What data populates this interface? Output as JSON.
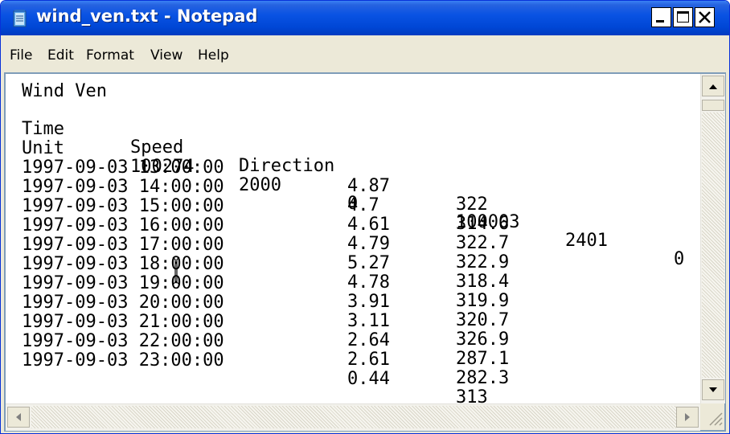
{
  "window": {
    "title": "wind_ven.txt - Notepad",
    "titlebar_color": "#0a53e3",
    "controls": [
      "minimize",
      "maximize",
      "close"
    ]
  },
  "menu": [
    "File",
    "Edit",
    "Format",
    "View",
    "Help"
  ],
  "document": {
    "title_line": "Wind Ven",
    "header": [
      "Time",
      "Speed",
      "Direction"
    ],
    "unit_row": [
      "Unit",
      "100274",
      "2000",
      "0",
      "100003",
      "2401",
      "0"
    ],
    "rows": [
      [
        "1997-09-03 13:00:00",
        "4.87",
        "322"
      ],
      [
        "1997-09-03 14:00:00",
        "4.7",
        "314.6"
      ],
      [
        "1997-09-03 15:00:00",
        "4.61",
        "322.7"
      ],
      [
        "1997-09-03 16:00:00",
        "4.79",
        "322.9"
      ],
      [
        "1997-09-03 17:00:00",
        "5.27",
        "318.4"
      ],
      [
        "1997-09-03 18:00:00",
        "4.78",
        "319.9"
      ],
      [
        "1997-09-03 19:00:00",
        "3.91",
        "320.7"
      ],
      [
        "1997-09-03 20:00:00",
        "3.11",
        "326.9"
      ],
      [
        "1997-09-03 21:00:00",
        "2.64",
        "287.1"
      ],
      [
        "1997-09-03 22:00:00",
        "2.61",
        "282.3"
      ],
      [
        "1997-09-03 23:00:00",
        "0.44",
        "313"
      ]
    ]
  }
}
